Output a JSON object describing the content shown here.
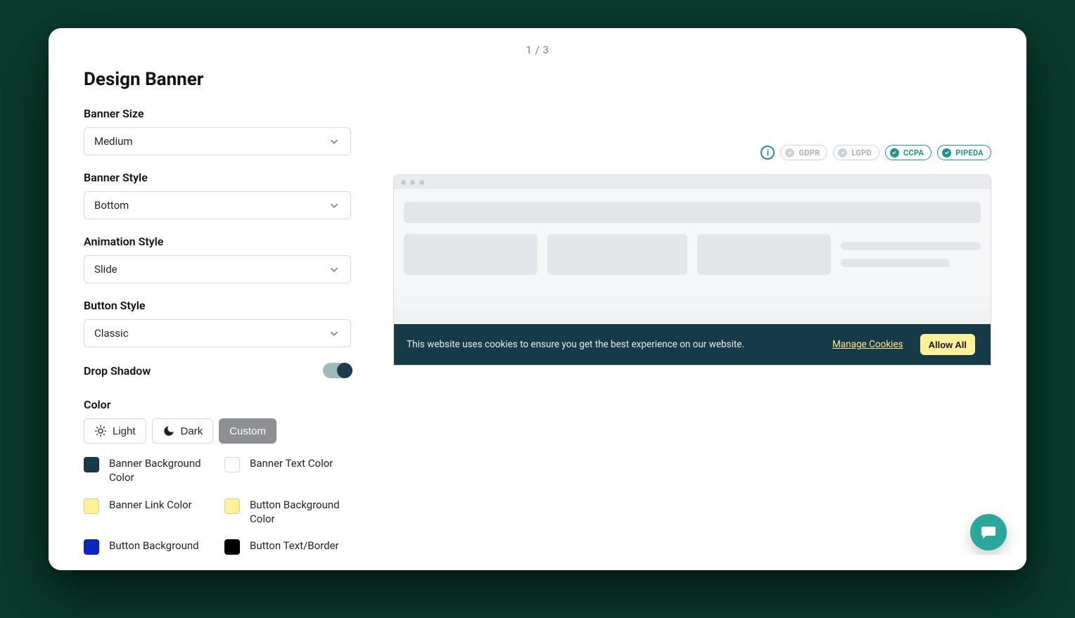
{
  "pager": "1 / 3",
  "title": "Design Banner",
  "fields": {
    "banner_size": {
      "label": "Banner Size",
      "value": "Medium"
    },
    "banner_style": {
      "label": "Banner Style",
      "value": "Bottom"
    },
    "animation_style": {
      "label": "Animation Style",
      "value": "Slide"
    },
    "button_style": {
      "label": "Button Style",
      "value": "Classic"
    }
  },
  "drop_shadow": {
    "label": "Drop Shadow",
    "on": true
  },
  "color_section": {
    "label": "Color",
    "modes": {
      "light": "Light",
      "dark": "Dark",
      "custom": "Custom"
    },
    "active_mode": "custom",
    "swatches": [
      {
        "name": "Banner Background Color",
        "hex": "#173a49"
      },
      {
        "name": "Banner Text Color",
        "hex": "#ffffff"
      },
      {
        "name": "Banner Link Color",
        "hex": "#fff19a"
      },
      {
        "name": "Button Background Color",
        "hex": "#fff19a"
      },
      {
        "name": "Button Background",
        "hex": "#0b26c8"
      },
      {
        "name": "Button Text/Border",
        "hex": "#000000"
      }
    ]
  },
  "compliance": {
    "chips": [
      {
        "code": "GDPR",
        "active": false
      },
      {
        "code": "LGPD",
        "active": false
      },
      {
        "code": "CCPA",
        "active": true
      },
      {
        "code": "PIPEDA",
        "active": true
      }
    ]
  },
  "preview_banner": {
    "message": "This website uses cookies to ensure you get the best experience on our website.",
    "manage_label": "Manage Cookies",
    "allow_label": "Allow All",
    "bg": "#173a49",
    "link_color": "#ffe98a",
    "button_bg": "#fff19a"
  }
}
